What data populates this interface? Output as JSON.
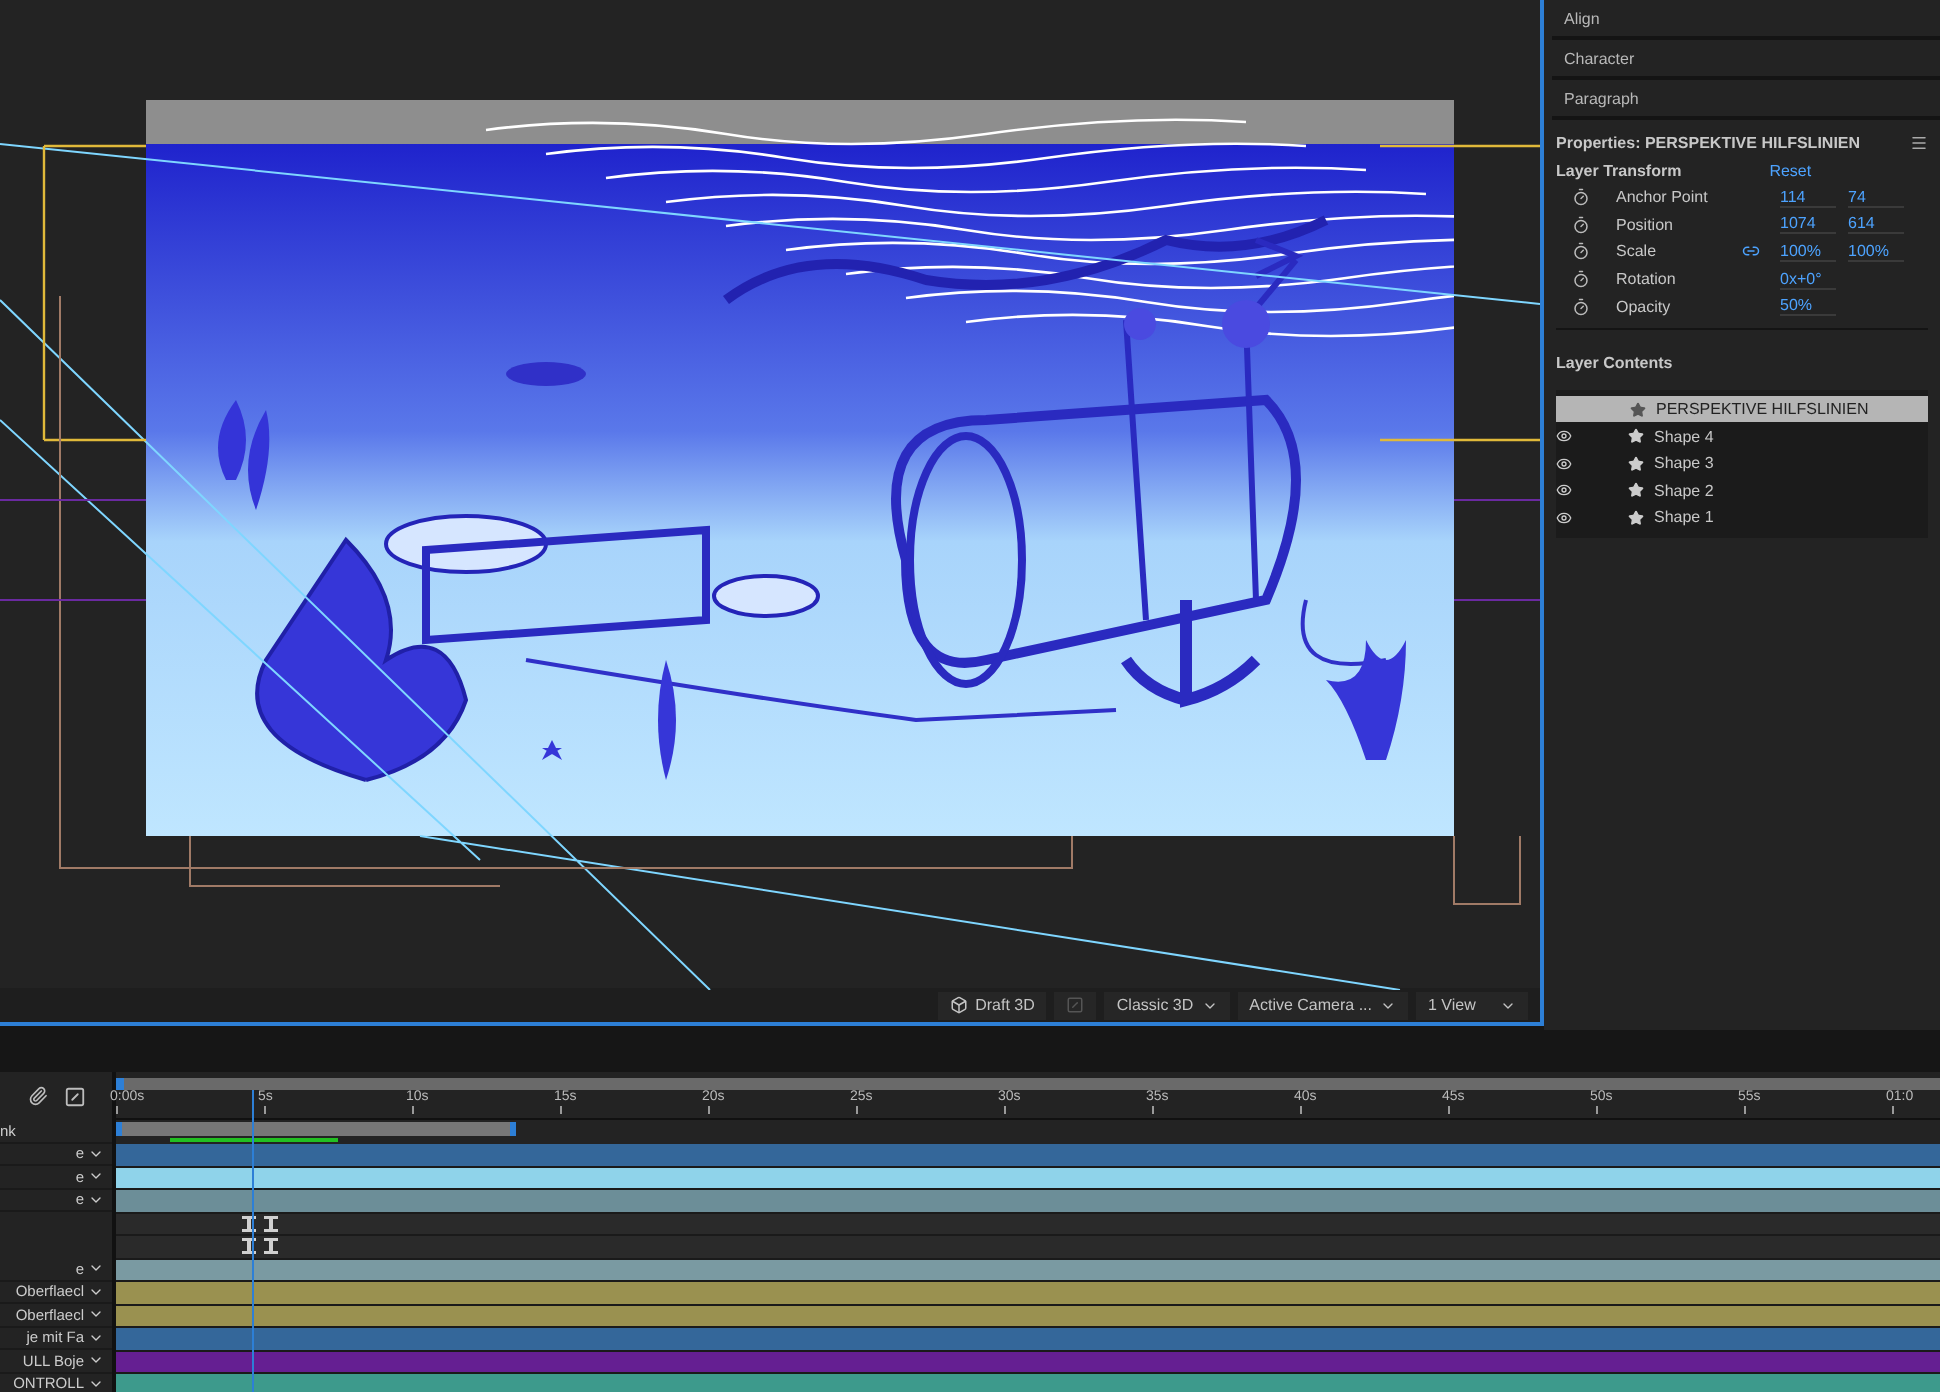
{
  "panels": [
    {
      "label": "Align"
    },
    {
      "label": "Character"
    },
    {
      "label": "Paragraph"
    }
  ],
  "properties": {
    "title": "Properties: PERSPEKTIVE HILFSLINIEN",
    "section": "Layer Transform",
    "reset": "Reset",
    "rows": [
      {
        "name": "Anchor Point",
        "linked": false,
        "values": [
          "114",
          "74"
        ]
      },
      {
        "name": "Position",
        "linked": false,
        "values": [
          "1074",
          "614"
        ]
      },
      {
        "name": "Scale",
        "linked": true,
        "values": [
          "100%",
          "100%"
        ]
      },
      {
        "name": "Rotation",
        "linked": false,
        "values": [
          "0x+0°"
        ]
      },
      {
        "name": "Opacity",
        "linked": false,
        "values": [
          "50%"
        ]
      }
    ],
    "contents_title": "Layer Contents",
    "contents": [
      {
        "label": "PERSPEKTIVE HILFSLINIEN",
        "selected": true,
        "visible": false,
        "children": [
          {
            "label": "Shape 4",
            "selected": false,
            "visible": true
          },
          {
            "label": "Shape 3",
            "selected": false,
            "visible": true
          },
          {
            "label": "Shape 2",
            "selected": false,
            "visible": true
          },
          {
            "label": "Shape 1",
            "selected": false,
            "visible": true
          }
        ]
      }
    ]
  },
  "viewer_toolbar": [
    {
      "kind": "toggle",
      "label": "Draft 3D"
    },
    {
      "kind": "icons"
    },
    {
      "kind": "dropdown",
      "label": "Classic 3D"
    },
    {
      "kind": "dropdown",
      "label": "Active Camera ..."
    },
    {
      "kind": "dropdown",
      "label": "1 View"
    }
  ],
  "timeline": {
    "ruler": [
      "0:00s",
      "5s",
      "10s",
      "15s",
      "20s",
      "25s",
      "30s",
      "35s",
      "40s",
      "45s",
      "50s",
      "55s",
      "01:0"
    ],
    "header": "nk",
    "layers": [
      {
        "kind": "bar",
        "name": "e",
        "color": "#34679a"
      },
      {
        "kind": "bar",
        "name": "e",
        "color": "#8fd3ea"
      },
      {
        "kind": "bar",
        "name": "e",
        "color": "#6c8e98"
      },
      {
        "kind": "keyframes"
      },
      {
        "kind": "keyframes"
      },
      {
        "kind": "bar",
        "name": "e",
        "color": "#7a9aa2"
      },
      {
        "kind": "bar",
        "name": "Oberflaecl",
        "color": "#9a9150"
      },
      {
        "kind": "bar",
        "name": "Oberflaecl",
        "color": "#9a9150"
      },
      {
        "kind": "bar",
        "name": "je mit Fa",
        "color": "#34679a"
      },
      {
        "kind": "bar",
        "name": "ULL Boje",
        "color": "#651f92"
      },
      {
        "kind": "bar",
        "name": "ONTROLL",
        "color": "#3d9a8c"
      }
    ]
  }
}
